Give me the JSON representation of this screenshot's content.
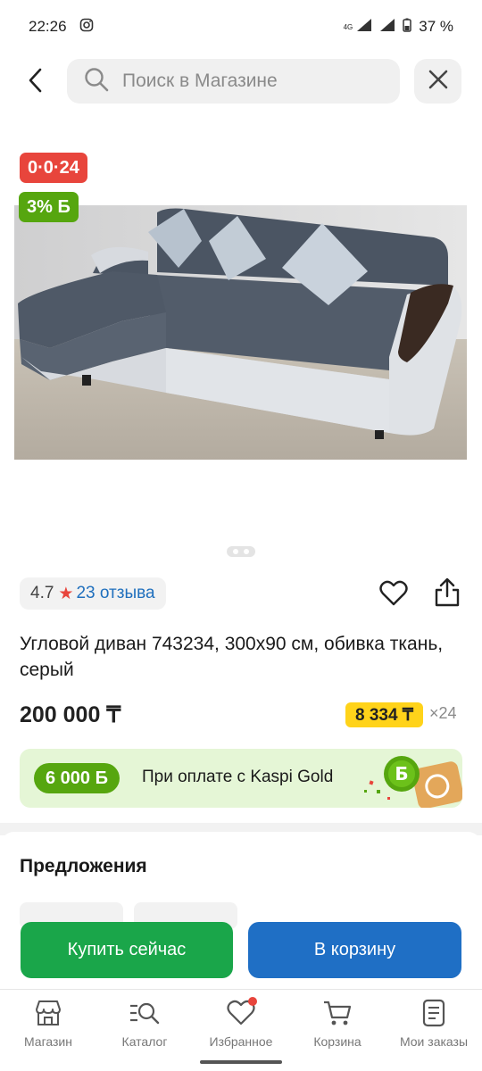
{
  "status_bar": {
    "time": "22:26",
    "network": "4G",
    "battery": "37 %"
  },
  "search": {
    "placeholder": "Поиск в Магазине"
  },
  "badges": {
    "promo": "0·0·24",
    "bonus": "3% Б"
  },
  "product": {
    "image_subject": "sofa",
    "rating": "4.7",
    "reviews": "23 отзыва",
    "title": "Угловой диван 743234, 300х90 см, обивка ткань, серый",
    "price": "200 000 ₸",
    "installment_amount": "8 334 ₸",
    "installment_term": "×24"
  },
  "kaspi_gold": {
    "bonus": "6 000 Б",
    "text": "При оплате с Kaspi Gold"
  },
  "offers": {
    "title": "Предложения"
  },
  "actions": {
    "buy_now": "Купить сейчас",
    "add_to_cart": "В корзину"
  },
  "bottom_nav": {
    "items": [
      {
        "label": "Магазин",
        "icon": "store-icon"
      },
      {
        "label": "Каталог",
        "icon": "catalog-search-icon"
      },
      {
        "label": "Избранное",
        "icon": "heart-icon",
        "badge": true
      },
      {
        "label": "Корзина",
        "icon": "cart-icon"
      },
      {
        "label": "Мои заказы",
        "icon": "orders-icon"
      }
    ]
  },
  "colors": {
    "promo_red": "#e8453c",
    "bonus_green": "#56a60f",
    "installment_yellow": "#ffd31a",
    "buy_green": "#1aa64a",
    "cart_blue": "#1f6fc5",
    "link_blue": "#1f6fbd"
  }
}
